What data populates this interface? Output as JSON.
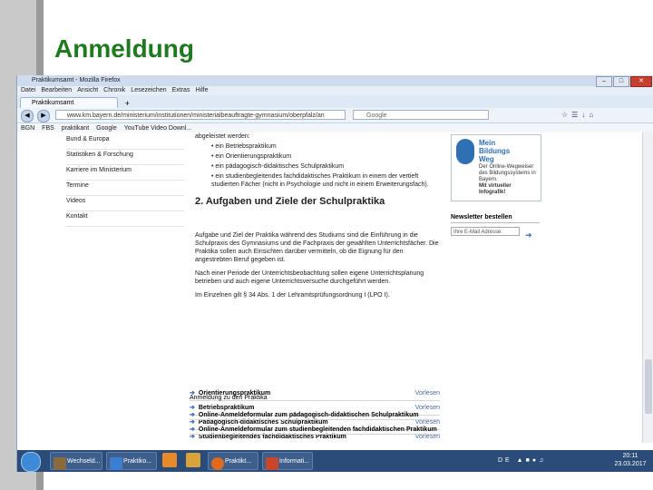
{
  "slide": {
    "title": "Anmeldung"
  },
  "browser": {
    "title": "Praktikumsamt - Mozilla Firefox",
    "menu": [
      "Datei",
      "Bearbeiten",
      "Ansicht",
      "Chronik",
      "Lesezeichen",
      "Extras",
      "Hilfe"
    ],
    "tab_label": "Praktikumsamt",
    "url": "www.km.bayern.de/ministerium/institutionen/ministerialbeauftragte-gymnasium/oberpfalz/an",
    "search_placeholder": "Google",
    "bookmarks": [
      "BGN",
      "FBS",
      "praktikant",
      "Google",
      "YouTube Video Downl..."
    ]
  },
  "sidebar": {
    "items": [
      "Bund & Europa",
      "Statistiken & Forschung",
      "Karriere im Ministerium",
      "Termine",
      "Videos",
      "Kontakt"
    ]
  },
  "content": {
    "intro": "abgeleistet werden:",
    "bullets": [
      "ein Betriebspraktikum",
      "ein Orientierungspraktikum",
      "ein pädagogisch-didaktisches Schulpraktikum",
      "ein studienbegleitendes fachdidaktisches Praktikum in einem der vertieft studierten Fächer (nicht in Psychologie und nicht in einem Erweiterungsfach)."
    ],
    "heading": "2. Aufgaben und Ziele der Schulpraktika",
    "para1": "Aufgabe und Ziel der Praktika während des Studiums sind die Einführung in die Schulpraxis des Gymnasiums und die Fachpraxis der gewählten Unterrichtsfächer. Die Praktika sollen auch Einsichten darüber vermitteln, ob die Eignung für den angestrebten Beruf gegeben ist.",
    "para2": "Nach einer Periode der Unterrichtsbeobachtung sollen eigene Unterrichtsplanung betrieben und auch eigene Unterrichtsversuche durchgeführt werden.",
    "para3": "Im Einzelnen gilt § 34 Abs. 1 der Lehramtsprüfungsordnung I (LPO I).",
    "links": [
      "Orientierungspraktikum",
      "Betriebspraktikum",
      "Pädagogisch-didaktisches Schulpraktikum",
      "Studienbegleitendes fachdidaktisches Praktikum"
    ],
    "link_action": "Vorlesen",
    "anmeldung_heading": "Anmeldung zu den Praktika",
    "online_links": [
      "Online-Anmeldeformular zum pädagogisch-didaktischen Schulpraktikum",
      "Online-Anmeldeformular zum studienbegleitenden fachdidaktischen Praktikum"
    ]
  },
  "promo": {
    "title_lines": [
      "Mein",
      "Bildungs",
      "Weg"
    ],
    "desc_lines": [
      "Der Online-Wegweiser",
      "des Bildungssystems in",
      "Bayern.",
      "Mit virtueller Infografik!"
    ]
  },
  "newsletter": {
    "heading": "Newsletter bestellen",
    "placeholder": "Ihre E-Mail Adresse:"
  },
  "taskbar": {
    "items": [
      "Wechseld...",
      "Praktiko...",
      "Praktikt...",
      "Informati..."
    ],
    "tray": "DE",
    "time": "20:11",
    "date": "23.03.2017"
  },
  "colors": {
    "title": "#1f7a1f",
    "link": "#2b63b8",
    "taskbar": "#2b4c78"
  }
}
